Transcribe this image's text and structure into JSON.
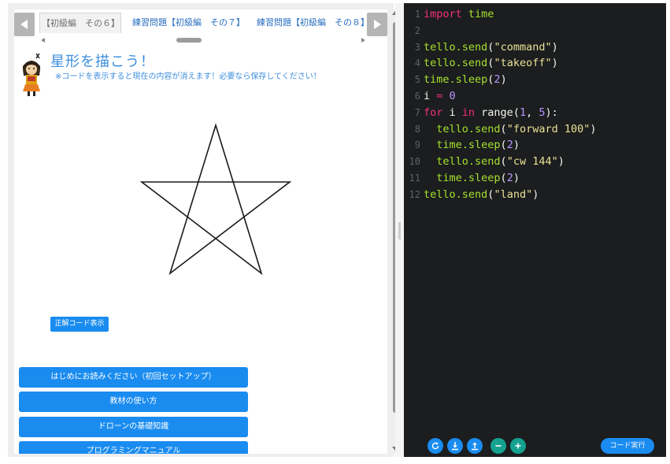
{
  "tabs": {
    "items": [
      {
        "label": "【初級編　その６】",
        "active": true
      },
      {
        "label": "練習問題【初級編　その７】",
        "active": false
      },
      {
        "label": "練習問題【初級編　その８】",
        "active": false
      }
    ]
  },
  "lesson": {
    "title": "星形を描こう！",
    "note": "※コードを表示すると現在の内容が消えます！必要なら保存してください！",
    "answer_button": "正解コード表示"
  },
  "menu": {
    "items": [
      "はじめにお読みください（初回セットアップ）",
      "教材の使い方",
      "ドローンの基礎知識",
      "プログラミングマニュアル"
    ]
  },
  "editor": {
    "lines": [
      {
        "n": "1",
        "tokens": [
          {
            "t": "import",
            "c": "kw"
          },
          {
            "t": " ",
            "c": "plain"
          },
          {
            "t": "time",
            "c": "fn"
          }
        ]
      },
      {
        "n": "2",
        "tokens": []
      },
      {
        "n": "3",
        "tokens": [
          {
            "t": "tello.",
            "c": "fn"
          },
          {
            "t": "send",
            "c": "fn"
          },
          {
            "t": "(",
            "c": "plain"
          },
          {
            "t": "\"command\"",
            "c": "str"
          },
          {
            "t": ")",
            "c": "plain"
          }
        ]
      },
      {
        "n": "4",
        "tokens": [
          {
            "t": "tello.",
            "c": "fn"
          },
          {
            "t": "send",
            "c": "fn"
          },
          {
            "t": "(",
            "c": "plain"
          },
          {
            "t": "\"takeoff\"",
            "c": "str"
          },
          {
            "t": ")",
            "c": "plain"
          }
        ]
      },
      {
        "n": "5",
        "tokens": [
          {
            "t": "time.",
            "c": "fn"
          },
          {
            "t": "sleep",
            "c": "fn"
          },
          {
            "t": "(",
            "c": "plain"
          },
          {
            "t": "2",
            "c": "num"
          },
          {
            "t": ")",
            "c": "plain"
          }
        ]
      },
      {
        "n": "6",
        "tokens": [
          {
            "t": "i",
            "c": "plain"
          },
          {
            "t": " = ",
            "c": "kw"
          },
          {
            "t": "0",
            "c": "num"
          }
        ]
      },
      {
        "n": "7",
        "tokens": [
          {
            "t": "for",
            "c": "kw"
          },
          {
            "t": " i ",
            "c": "plain"
          },
          {
            "t": "in",
            "c": "kw"
          },
          {
            "t": " range(",
            "c": "plain"
          },
          {
            "t": "1",
            "c": "num"
          },
          {
            "t": ", ",
            "c": "plain"
          },
          {
            "t": "5",
            "c": "num"
          },
          {
            "t": "):",
            "c": "plain"
          }
        ]
      },
      {
        "n": "8",
        "tokens": [
          {
            "t": "  tello.",
            "c": "fn"
          },
          {
            "t": "send",
            "c": "fn"
          },
          {
            "t": "(",
            "c": "plain"
          },
          {
            "t": "\"forward 100\"",
            "c": "str"
          },
          {
            "t": ")",
            "c": "plain"
          }
        ]
      },
      {
        "n": "9",
        "tokens": [
          {
            "t": "  time.",
            "c": "fn"
          },
          {
            "t": "sleep",
            "c": "fn"
          },
          {
            "t": "(",
            "c": "plain"
          },
          {
            "t": "2",
            "c": "num"
          },
          {
            "t": ")",
            "c": "plain"
          }
        ]
      },
      {
        "n": "10",
        "tokens": [
          {
            "t": "  tello.",
            "c": "fn"
          },
          {
            "t": "send",
            "c": "fn"
          },
          {
            "t": "(",
            "c": "plain"
          },
          {
            "t": "\"cw 144\"",
            "c": "str"
          },
          {
            "t": ")",
            "c": "plain"
          }
        ]
      },
      {
        "n": "11",
        "tokens": [
          {
            "t": "  time.",
            "c": "fn"
          },
          {
            "t": "sleep",
            "c": "fn"
          },
          {
            "t": "(",
            "c": "plain"
          },
          {
            "t": "2",
            "c": "num"
          },
          {
            "t": ")",
            "c": "plain"
          }
        ]
      },
      {
        "n": "12",
        "tokens": [
          {
            "t": "tello.",
            "c": "fn"
          },
          {
            "t": "send",
            "c": "fn"
          },
          {
            "t": "(",
            "c": "plain"
          },
          {
            "t": "\"land\"",
            "c": "str"
          },
          {
            "t": ")",
            "c": "plain"
          }
        ]
      }
    ],
    "toolbar": {
      "icons": [
        "reload-icon",
        "download-icon",
        "upload-icon",
        "zoom-out-icon",
        "zoom-in-icon"
      ],
      "run_label": "コード実行"
    }
  },
  "colors": {
    "accent": "#1a8cf0",
    "teal": "#15a290",
    "title": "#3d8ede",
    "editor_bg": "#1b1d1e",
    "keyword": "#f3307a",
    "string": "#eae096",
    "function": "#a6e22e",
    "number": "#b995ff"
  }
}
